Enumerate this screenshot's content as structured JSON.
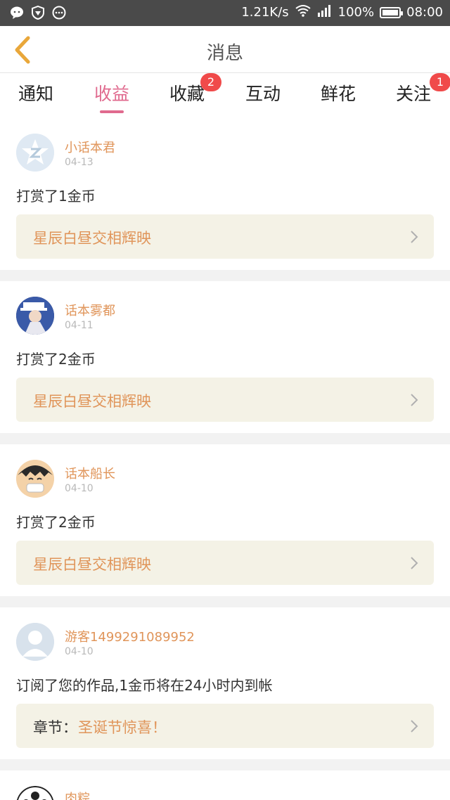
{
  "statusbar": {
    "speed": "1.21K/s",
    "battery": "100%",
    "time": "08:00"
  },
  "header": {
    "title": "消息"
  },
  "tabs": [
    {
      "label": "通知",
      "badge": ""
    },
    {
      "label": "收益",
      "badge": ""
    },
    {
      "label": "收藏",
      "badge": "2"
    },
    {
      "label": "互动",
      "badge": ""
    },
    {
      "label": "鲜花",
      "badge": ""
    },
    {
      "label": "关注",
      "badge": "1"
    }
  ],
  "messages": [
    {
      "user": "小话本君",
      "date": "04-13",
      "text": "打赏了1金币",
      "work_label": "",
      "work_title": "星辰白昼交相辉映"
    },
    {
      "user": "话本雾都",
      "date": "04-11",
      "text": "打赏了2金币",
      "work_label": "",
      "work_title": "星辰白昼交相辉映"
    },
    {
      "user": "话本船长",
      "date": "04-10",
      "text": "打赏了2金币",
      "work_label": "",
      "work_title": "星辰白昼交相辉映"
    },
    {
      "user": "游客1499291089952",
      "date": "04-10",
      "text": "订阅了您的作品,1金币将在24小时内到帐",
      "work_label": "章节：",
      "work_title": "圣诞节惊喜！"
    },
    {
      "user": "肉粽",
      "date": "",
      "text": "",
      "work_label": "",
      "work_title": ""
    }
  ],
  "colors": {
    "accent": "#e06a8e",
    "username": "#e0955a",
    "badge": "#f04a4a",
    "back_arrow": "#e9a73a"
  }
}
